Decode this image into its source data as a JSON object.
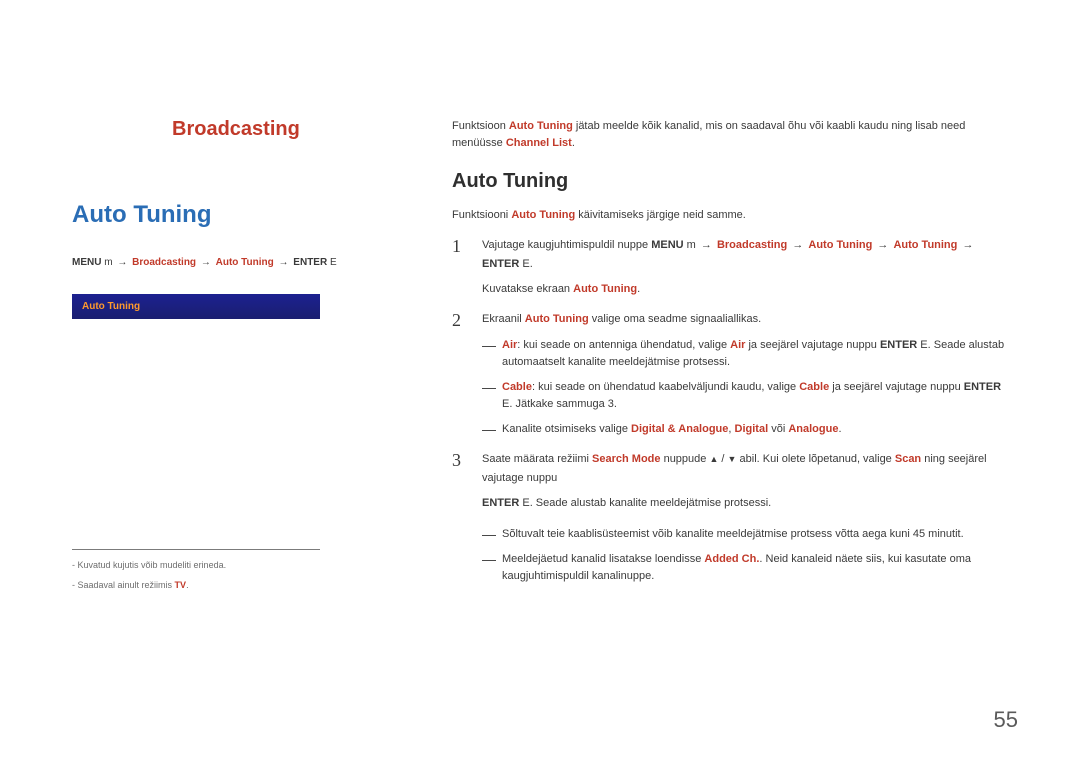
{
  "chapter": "Broadcasting",
  "left": {
    "title": "Auto Tuning",
    "menu_path": {
      "menu": "MENU",
      "m": "m",
      "sep1": "→",
      "bc": "Broadcasting",
      "sep2": "→",
      "at": "Auto Tuning",
      "sep3": "→",
      "enter": "ENTER",
      "e": "E"
    },
    "ui_label": "Auto Tuning",
    "foot1": "-  Kuvatud kujutis võib mudeliti erineda.",
    "foot2_prefix": "-  Saadaval ainult režiimis ",
    "foot2_tv": "TV",
    "foot2_suffix": "."
  },
  "right": {
    "intro_a": "Funktsioon ",
    "intro_at": "Auto Tuning",
    "intro_b": " jätab meelde kõik kanalid, mis on saadaval õhu või kaabli kaudu ning lisab need menüüsse ",
    "intro_cl": "Channel List",
    "intro_c": ".",
    "sub_title": "Auto Tuning",
    "sub_intro_a": "Funktsiooni ",
    "sub_intro_at": "Auto Tuning",
    "sub_intro_b": " käivitamiseks järgige neid samme.",
    "step1": {
      "num": "1",
      "a": "Vajutage kaugjuhtimispuldil nuppe ",
      "menu": "MENU",
      "m": "m",
      "arrow": "→",
      "bc": "Broadcasting",
      "at": "Auto Tuning",
      "at2": "Auto Tuning",
      "enter": "ENTER",
      "e": "E",
      "tail": ".",
      "line2a": "Kuvatakse ekraan ",
      "line2b": "Auto Tuning",
      "line2c": "."
    },
    "step2": {
      "num": "2",
      "a": "Ekraanil ",
      "at": "Auto Tuning",
      "b": " valige oma seadme signaaliallikas.",
      "dash1_a": "Air",
      "dash1_b": ": kui seade on antenniga ühendatud, valige ",
      "dash1_c": "Air",
      "dash1_d": " ja seejärel vajutage nuppu ",
      "dash1_enter": "ENTER",
      "dash1_e": "E",
      "dash1_tail": ". Seade alustab automaatselt kanalite meeldejätmise protsessi.",
      "dash2_a": "Cable",
      "dash2_b": ": kui seade on ühendatud kaabelväljundi kaudu, valige ",
      "dash2_c": "Cable",
      "dash2_d": " ja seejärel vajutage nuppu ",
      "dash2_enter": "ENTER",
      "dash2_e": "E",
      "dash2_tail": ". Jätkake sammuga 3.",
      "dash3_a": "Kanalite otsimiseks valige ",
      "dash3_b": "Digital & Analogue",
      "dash3_comma": ", ",
      "dash3_c": "Digital",
      "dash3_mid": " või ",
      "dash3_d": "Analogue",
      "dash3_tail": "."
    },
    "step3": {
      "num": "3",
      "a": "Saate määrata režiimi ",
      "sm": "Search Mode",
      "b": " nuppude ",
      "c": " abil. Kui olete lõpetanud, valige ",
      "scan": "Scan",
      "d": " ning seejärel vajutage nuppu ",
      "enter": "ENTER",
      "e": "E",
      "tail": ". Seade alustab kanalite meeldejätmise protsessi."
    },
    "note1": "Sõltuvalt teie kaablisüsteemist võib kanalite meeldejätmise protsess võtta aega kuni 45 minutit.",
    "note2_a": "Meeldejäetud kanalid lisatakse loendisse ",
    "note2_b": "Added Ch.",
    "note2_c": ". Neid kanaleid näete siis, kui kasutate oma kaugjuhtimispuldil kanalinuppe."
  },
  "page_number": "55"
}
